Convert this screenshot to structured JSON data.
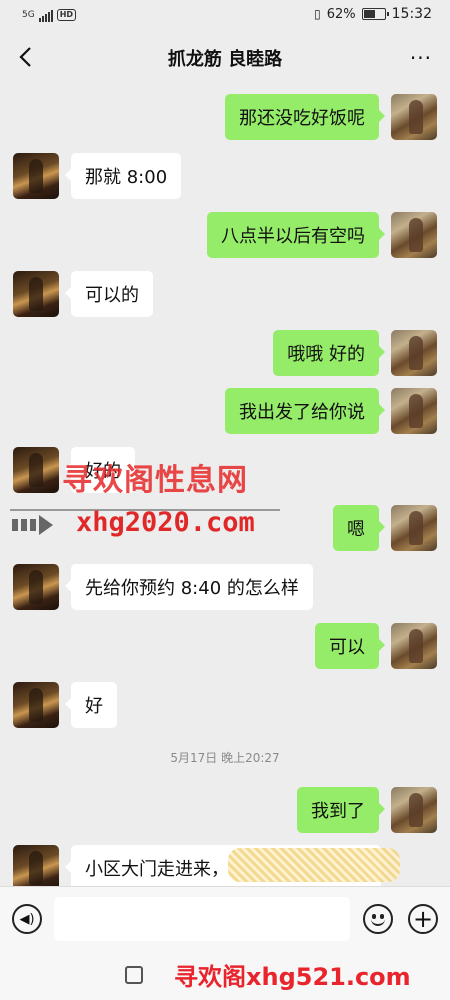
{
  "status_bar": {
    "network": "5G",
    "hd_badge": "HD",
    "battery_text": "62%",
    "battery_level": 0.62,
    "time": "15:32"
  },
  "header": {
    "title": "抓龙筋 良睦路",
    "back_icon": "chevron-left-icon",
    "more_icon": "more-dots-icon",
    "more_glyph": "···"
  },
  "messages": [
    {
      "side": "right",
      "text": "那还没吃好饭呢"
    },
    {
      "side": "left",
      "text": "那就 8:00"
    },
    {
      "side": "right",
      "text": "八点半以后有空吗"
    },
    {
      "side": "left",
      "text": "可以的"
    },
    {
      "side": "right",
      "text": "哦哦  好的"
    },
    {
      "side": "right",
      "text": "我出发了给你说"
    },
    {
      "side": "left",
      "text": "好的"
    },
    {
      "side": "right",
      "text": "嗯"
    },
    {
      "side": "left",
      "text": "先给你预约 8:40 的怎么样"
    },
    {
      "side": "right",
      "text": "可以"
    },
    {
      "side": "left",
      "text": "好"
    },
    {
      "side": "right",
      "text": "我到了"
    },
    {
      "side": "left",
      "text": "小区大门走进来，"
    }
  ],
  "timestamp": "5月17日 晚上20:27",
  "watermarks": {
    "middle_title": "寻欢阁性息网",
    "middle_url": "xhg2020.com",
    "bottom": "寻欢阁xhg521.com"
  },
  "input_bar": {
    "voice_icon": "voice-icon",
    "voice_glyph": "◀)",
    "emoji_icon": "emoji-icon",
    "plus_icon": "plus-icon",
    "plus_glyph": "+"
  },
  "colors": {
    "own_bubble": "#95ec69",
    "other_bubble": "#ffffff",
    "background": "#ededed",
    "watermark": "#e02828"
  }
}
